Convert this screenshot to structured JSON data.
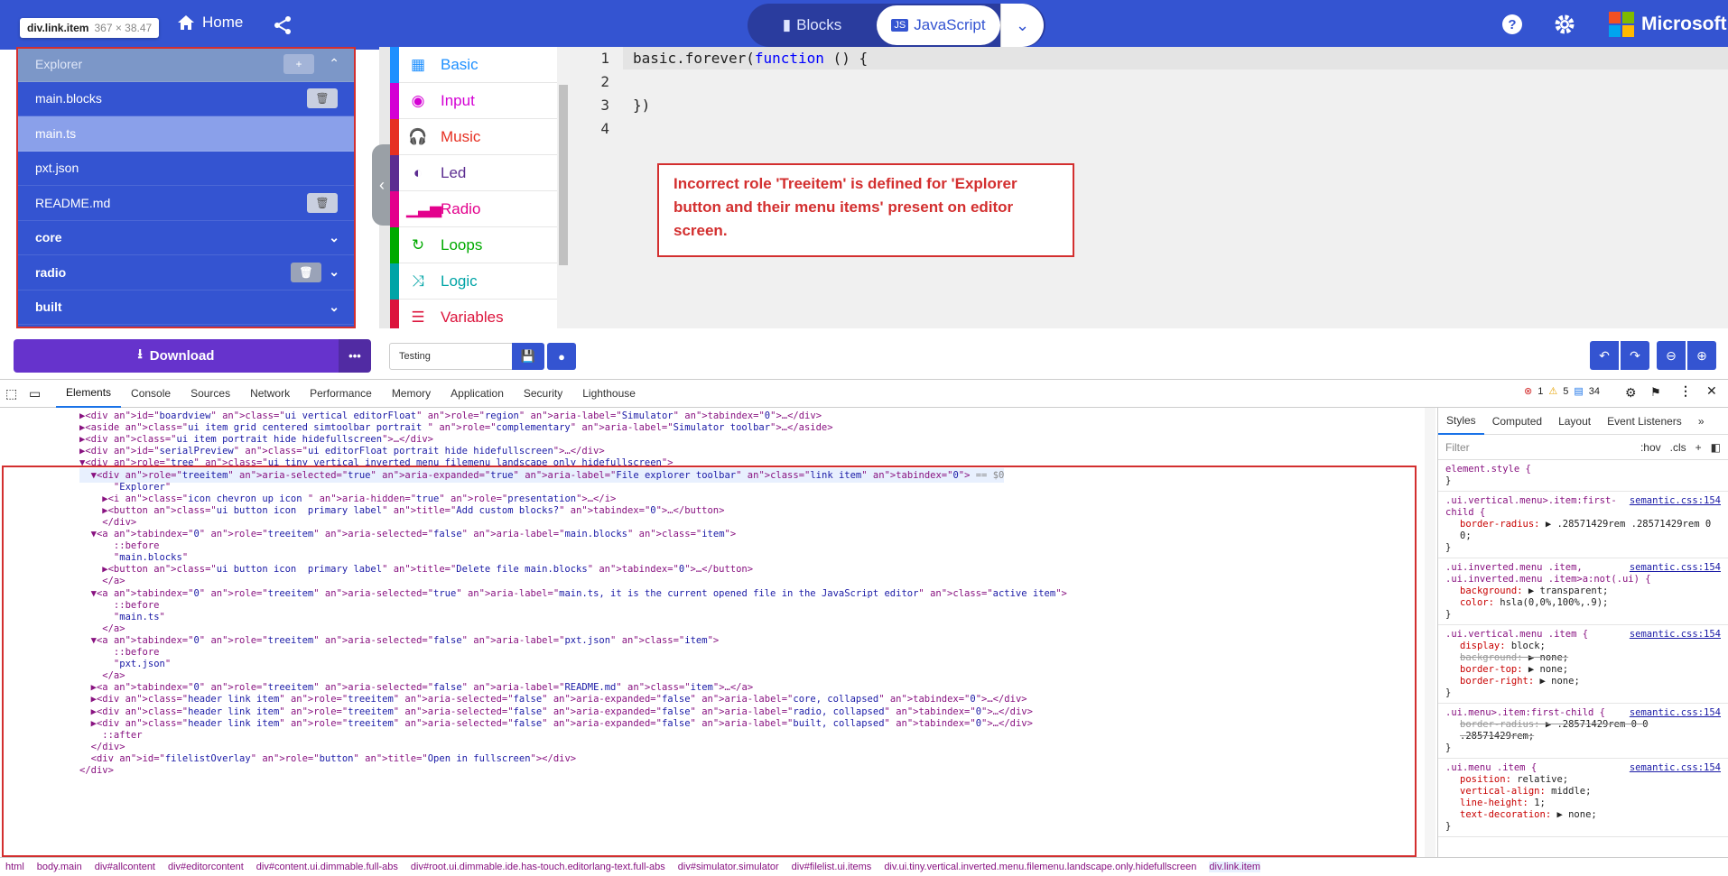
{
  "tooltip": {
    "name": "div.link.item",
    "size": "367 × 38.47"
  },
  "header": {
    "home_label": "Home",
    "blocks_label": "Blocks",
    "javascript_label": "JavaScript",
    "brand": "Microsoft"
  },
  "explorer": {
    "title": "Explorer",
    "files": [
      "main.blocks",
      "main.ts",
      "pxt.json",
      "README.md"
    ],
    "folders": [
      "core",
      "radio",
      "built"
    ]
  },
  "toolbox": {
    "categories": [
      {
        "label": "Basic",
        "color": "#1e90ff",
        "icon": "grid-icon"
      },
      {
        "label": "Input",
        "color": "#d400d4",
        "icon": "target-icon"
      },
      {
        "label": "Music",
        "color": "#e63022",
        "icon": "headphones-icon"
      },
      {
        "label": "Led",
        "color": "#5c2d91",
        "icon": "toggle-icon"
      },
      {
        "label": "Radio",
        "color": "#e3008c",
        "icon": "signal-icon"
      },
      {
        "label": "Loops",
        "color": "#00aa00",
        "icon": "loop-icon"
      },
      {
        "label": "Logic",
        "color": "#00a4a6",
        "icon": "shuffle-icon"
      },
      {
        "label": "Variables",
        "color": "#dc143c",
        "icon": "lines-icon"
      }
    ]
  },
  "code": {
    "lines": [
      {
        "n": "1",
        "text": "basic.forever(function () {"
      },
      {
        "n": "2",
        "text": ""
      },
      {
        "n": "3",
        "text": "})"
      },
      {
        "n": "4",
        "text": ""
      }
    ]
  },
  "annotation": "Incorrect role 'Treeitem' is defined for 'Explorer button and their menu items' present on editor screen.",
  "bottom": {
    "download_label": "Download",
    "more_label": "•••",
    "project_name": "Testing"
  },
  "devtools": {
    "tabs": [
      "Elements",
      "Console",
      "Sources",
      "Network",
      "Performance",
      "Memory",
      "Application",
      "Security",
      "Lighthouse"
    ],
    "errors": "1",
    "warnings": "5",
    "messages": "34",
    "dom_lines": [
      "▶<div id=\"boardview\" class=\"ui vertical editorFloat\" role=\"region\" aria-label=\"Simulator\" tabindex=\"0\">…</div>",
      "▶<aside class=\"ui item grid centered simtoolbar portrait \" role=\"complementary\" aria-label=\"Simulator toolbar\">…</aside>",
      "▶<div class=\"ui item portrait hide hidefullscreen\">…</div>",
      "▶<div id=\"serialPreview\" class=\"ui editorFloat portrait hide hidefullscreen\">…</div>",
      "▼<div role=\"tree\" class=\"ui tiny vertical inverted menu filemenu landscape only hidefullscreen\">",
      "  ▼<div role=\"treeitem\" aria-selected=\"true\" aria-expanded=\"true\" aria-label=\"File explorer toolbar\" class=\"link item\" tabindex=\"0\"> == $0",
      "      \"Explorer\"",
      "    ▶<i class=\"icon chevron up icon \" aria-hidden=\"true\" role=\"presentation\">…</i>",
      "    ▶<button class=\"ui button icon  primary label\" title=\"Add custom blocks?\" tabindex=\"0\">…</button>",
      "    </div>",
      "  ▼<a tabindex=\"0\" role=\"treeitem\" aria-selected=\"false\" aria-label=\"main.blocks\" class=\"item\">",
      "      ::before",
      "      \"main.blocks\"",
      "    ▶<button class=\"ui button icon  primary label\" title=\"Delete file main.blocks\" tabindex=\"0\">…</button>",
      "    </a>",
      "  ▼<a tabindex=\"0\" role=\"treeitem\" aria-selected=\"true\" aria-label=\"main.ts, it is the current opened file in the JavaScript editor\" class=\"active item\">",
      "      ::before",
      "      \"main.ts\"",
      "    </a>",
      "  ▼<a tabindex=\"0\" role=\"treeitem\" aria-selected=\"false\" aria-label=\"pxt.json\" class=\"item\">",
      "      ::before",
      "      \"pxt.json\"",
      "    </a>",
      "  ▶<a tabindex=\"0\" role=\"treeitem\" aria-selected=\"false\" aria-label=\"README.md\" class=\"item\">…</a>",
      "  ▶<div class=\"header link item\" role=\"treeitem\" aria-selected=\"false\" aria-expanded=\"false\" aria-label=\"core, collapsed\" tabindex=\"0\">…</div>",
      "  ▶<div class=\"header link item\" role=\"treeitem\" aria-selected=\"false\" aria-expanded=\"false\" aria-label=\"radio, collapsed\" tabindex=\"0\">…</div>",
      "  ▶<div class=\"header link item\" role=\"treeitem\" aria-selected=\"false\" aria-expanded=\"false\" aria-label=\"built, collapsed\" tabindex=\"0\">…</div>",
      "    ::after",
      "  </div>",
      "  <div id=\"filelistOverlay\" role=\"button\" title=\"Open in fullscreen\"></div>",
      "</div>"
    ],
    "styles_tabs": [
      "Styles",
      "Computed",
      "Layout",
      "Event Listeners"
    ],
    "filter_placeholder": "Filter",
    "hov": ":hov",
    "cls": ".cls",
    "rules": [
      {
        "selector": "element.style {",
        "source": "",
        "props": []
      },
      {
        "selector": ".ui.vertical.menu>.item:first-child {",
        "source": "semantic.css:154",
        "props": [
          {
            "p": "border-radius",
            "v": "▶ .28571429rem .28571429rem 0 0;",
            "s": false
          }
        ]
      },
      {
        "selector": ".ui.inverted.menu .item, .ui.inverted.menu .item>a:not(.ui) {",
        "source": "semantic.css:154",
        "props": [
          {
            "p": "background",
            "v": "▶ transparent;",
            "s": false
          },
          {
            "p": "color",
            "v": "hsla(0,0%,100%,.9);",
            "s": false
          }
        ]
      },
      {
        "selector": ".ui.vertical.menu .item {",
        "source": "semantic.css:154",
        "props": [
          {
            "p": "display",
            "v": "block;",
            "s": false
          },
          {
            "p": "background",
            "v": "▶ none;",
            "s": true
          },
          {
            "p": "border-top",
            "v": "▶ none;",
            "s": false
          },
          {
            "p": "border-right",
            "v": "▶ none;",
            "s": false
          }
        ]
      },
      {
        "selector": ".ui.menu>.item:first-child {",
        "source": "semantic.css:154",
        "props": [
          {
            "p": "border-radius",
            "v": "▶ .28571429rem 0 0 .28571429rem;",
            "s": true
          }
        ]
      },
      {
        "selector": ".ui.menu .item {",
        "source": "semantic.css:154",
        "props": [
          {
            "p": "position",
            "v": "relative;",
            "s": false
          },
          {
            "p": "vertical-align",
            "v": "middle;",
            "s": false
          },
          {
            "p": "line-height",
            "v": "1;",
            "s": false
          },
          {
            "p": "text-decoration",
            "v": "▶ none;",
            "s": false
          }
        ]
      }
    ],
    "breadcrumbs": [
      "html",
      "body.main",
      "div#allcontent",
      "div#editorcontent",
      "div#content.ui.dimmable.full-abs",
      "div#root.ui.dimmable.ide.has-touch.editorlang-text.full-abs",
      "div#simulator.simulator",
      "div#filelist.ui.items",
      "div.ui.tiny.vertical.inverted.menu.filemenu.landscape.only.hidefullscreen",
      "div.link.item"
    ]
  }
}
